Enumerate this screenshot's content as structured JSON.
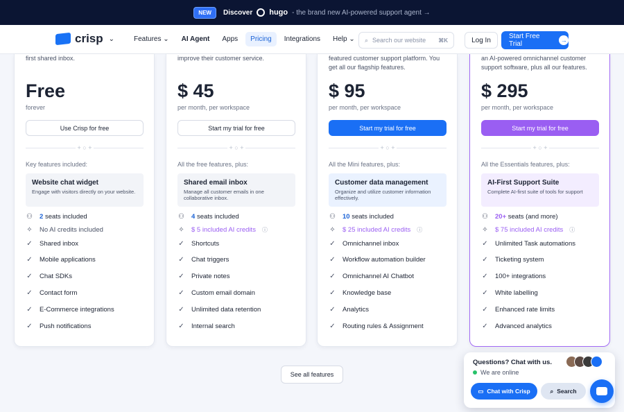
{
  "banner": {
    "badge": "NEW",
    "discover": "Discover",
    "brand": "hugo",
    "tagline": "- the brand new AI-powered support agent →"
  },
  "nav": {
    "logo": "crisp",
    "links": [
      "Features ⌄",
      "AI Agent",
      "Apps",
      "Pricing",
      "Integrations",
      "Help ⌄"
    ],
    "active_link": "Pricing",
    "search_placeholder": "Search our website",
    "search_kbd": "⌘K",
    "login": "Log In",
    "trial": "Start Free Trial"
  },
  "plans": [
    {
      "desc": "first shared inbox.",
      "price": "Free",
      "period": "forever",
      "cta": "Use Crisp for free",
      "features_heading": "Key features included:",
      "box_title": "Website chat widget",
      "box_desc": "Engage with visitors directly on your website.",
      "seats_num": "2",
      "seats_text": "seats included",
      "ai_text": "No AI credits included",
      "features": [
        "Shared inbox",
        "Mobile applications",
        "Chat SDKs",
        "Contact form",
        "E-Commerce integrations",
        "Push notifications"
      ]
    },
    {
      "desc": "improve their customer service.",
      "price": "$ 45",
      "period": "per month, per workspace",
      "cta": "Start my trial for free",
      "features_heading": "All the free features, plus:",
      "box_title": "Shared email inbox",
      "box_desc": "Manage all customer emails in one collaborative inbox.",
      "seats_num": "4",
      "seats_text": "seats included",
      "ai_text": "$ 5 included AI credits",
      "features": [
        "Shortcuts",
        "Chat triggers",
        "Private notes",
        "Custom email domain",
        "Unlimited data retention",
        "Internal search"
      ]
    },
    {
      "desc": "featured customer support platform. You get all our flagship features.",
      "price": "$ 95",
      "period": "per month, per workspace",
      "cta": "Start my trial for free",
      "features_heading": "All the Mini features, plus:",
      "box_title": "Customer data management",
      "box_desc": "Organize and utilize customer information effectively.",
      "seats_num": "10",
      "seats_text": "seats included",
      "ai_text": "$ 25 included AI credits",
      "features": [
        "Omnichannel inbox",
        "Workflow automation builder",
        "Omnichannel AI Chatbot",
        "Knowledge base",
        "Analytics",
        "Routing rules & Assignment"
      ]
    },
    {
      "desc": "an AI-powered omnichannel customer support software, plus all our features.",
      "price": "$ 295",
      "period": "per month, per workspace",
      "cta": "Start my trial for free",
      "features_heading": "All the Essentials features, plus:",
      "box_title": "AI-First Support Suite",
      "box_desc": "Complete AI-first suite of tools for support",
      "seats_num": "20+",
      "seats_text": "seats (and more)",
      "ai_text": "$ 75 included AI credits",
      "features": [
        "Unlimited Task automations",
        "Ticketing system",
        "100+ integrations",
        "White labelling",
        "Enhanced rate limits",
        "Advanced analytics"
      ]
    }
  ],
  "see_all": "See all features",
  "chat": {
    "title": "Questions? Chat with us.",
    "status": "We are online",
    "chat_button": "Chat with Crisp",
    "search_button": "Search"
  },
  "colors": {
    "accent": "#1a6ff5",
    "suite": "#9a5ef2",
    "banner_bg": "#0b1533"
  }
}
